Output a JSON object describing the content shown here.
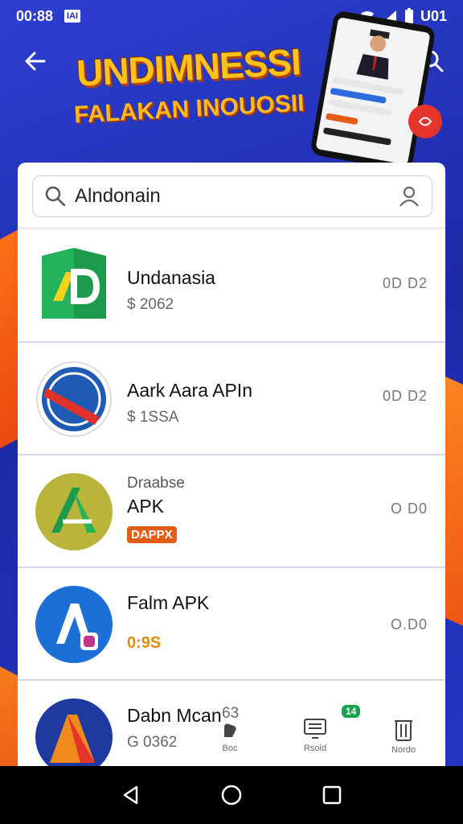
{
  "status_bar": {
    "time": "00:88",
    "app_badge": "IAI",
    "right_text": "U01"
  },
  "header": {
    "back_icon": "arrow-left-icon",
    "search_icon": "search-icon",
    "banner_title": "UNDIMNESSI",
    "banner_subtitle": "FALAKAN INOUOSII"
  },
  "search": {
    "value": "Alndonain",
    "icon": "search-icon",
    "right_icon": "user-icon"
  },
  "apps": [
    {
      "name": "Undanasia",
      "sub": "$ 2062",
      "size": "0D D2"
    },
    {
      "name": "Aark Aara APIn",
      "sub": "$ 1SSA",
      "size": "0D D2"
    },
    {
      "small": "Draabse",
      "name": "APK",
      "badge": "DAPPX",
      "size": "O D0"
    },
    {
      "name": "Falm APK",
      "price": "0:9S",
      "size": "O.D0"
    },
    {
      "name": "Dabn Mcan",
      "sub": "G 0362",
      "extra": "63"
    }
  ],
  "toolbar": {
    "items": [
      {
        "label": "Boc",
        "icon": "hand-icon"
      },
      {
        "label": "Rsoid",
        "icon": "monitor-icon",
        "badge": "14"
      },
      {
        "label": "Nordo",
        "icon": "trash-icon"
      }
    ]
  },
  "colors": {
    "background": "#2436c4",
    "accent_orange": "#e35d17",
    "banner_yellow": "#ffc21a",
    "badge_green": "#17a34a"
  }
}
